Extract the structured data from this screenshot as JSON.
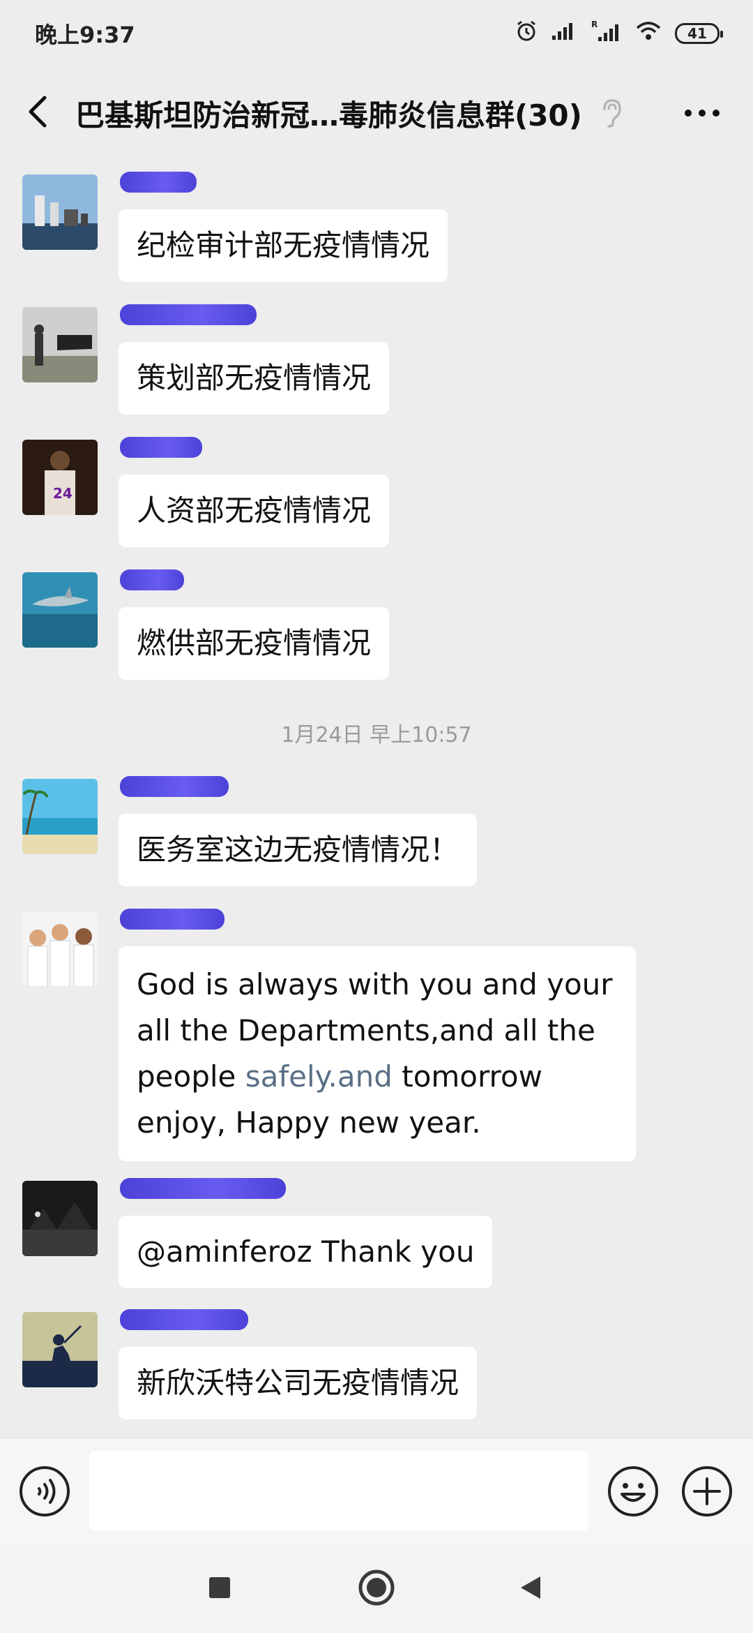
{
  "status_bar": {
    "time": "晚上9:37",
    "battery": "41"
  },
  "header": {
    "title": "巴基斯坦防治新冠…毒肺炎信息群(30)"
  },
  "messages": [
    {
      "text": "纪检审计部无疫情情况"
    },
    {
      "text": "策划部无疫情情况"
    },
    {
      "text": "人资部无疫情情况"
    },
    {
      "text": "燃供部无疫情情况"
    },
    {
      "text": "医务室这边无疫情情况！"
    },
    {
      "text_before": "God is always with you and your all the Departments,and all the people ",
      "text_link": "safely.and",
      "text_after": " tomorrow enjoy, Happy new year."
    },
    {
      "text": "@aminferoz   Thank you"
    },
    {
      "text": "新欣沃特公司无疫情情况"
    }
  ],
  "timestamp": "1月24日 早上10:57",
  "input": {
    "value": ""
  },
  "colors": {
    "background": "#ededed",
    "bubble": "#ffffff",
    "redaction": "#3a2fd6",
    "link": "#5a6f86"
  },
  "icons": {
    "back": "chevron-left-icon",
    "ear": "ear-icon",
    "more": "more-dots-icon",
    "voice": "voice-icon",
    "emoji": "emoji-icon",
    "plus": "plus-icon"
  }
}
